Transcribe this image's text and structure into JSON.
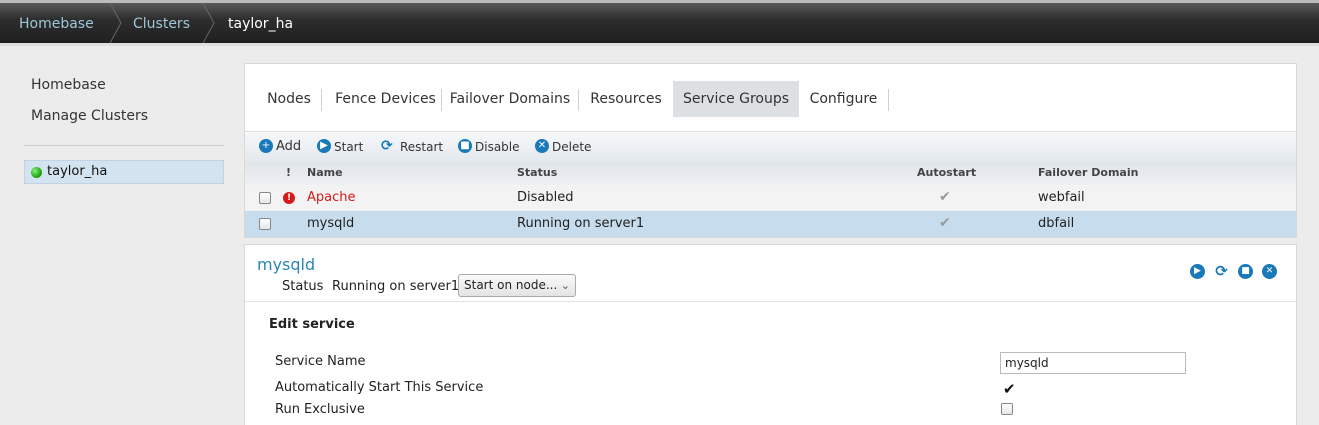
{
  "breadcrumb": {
    "items": [
      "Homebase",
      "Clusters"
    ],
    "current": "taylor_ha"
  },
  "sidebar": {
    "links": [
      "Homebase",
      "Manage Clusters"
    ],
    "cluster": {
      "name": "taylor_ha",
      "status_color": "#22a812"
    }
  },
  "tabs": [
    "Nodes",
    "Fence Devices",
    "Failover Domains",
    "Resources",
    "Service Groups",
    "Configure"
  ],
  "active_tab": "Service Groups",
  "toolbar": {
    "add": "Add",
    "start": "Start",
    "restart": "Restart",
    "disable": "Disable",
    "delete": "Delete"
  },
  "table": {
    "headers": {
      "flag": "!",
      "name": "Name",
      "status": "Status",
      "autostart": "Autostart",
      "failover": "Failover Domain"
    },
    "rows": [
      {
        "name": "Apache",
        "status": "Disabled",
        "autostart": true,
        "failover": "webfail",
        "error": true,
        "selected": false
      },
      {
        "name": "mysqld",
        "status": "Running on server1",
        "autostart": true,
        "failover": "dbfail",
        "error": false,
        "selected": true
      }
    ]
  },
  "detail": {
    "title": "mysqld",
    "status_label": "Status",
    "status_value": "Running on server1",
    "start_select": "Start on node...",
    "edit_heading": "Edit service",
    "fields": {
      "service_name_label": "Service Name",
      "service_name_value": "mysqld",
      "autostart_label": "Automatically Start This Service",
      "autostart_checked": true,
      "exclusive_label": "Run Exclusive",
      "exclusive_checked": false
    }
  },
  "colors": {
    "accent": "#1a79b8",
    "error": "#d61a1a",
    "selected_row": "#c7dcec",
    "link_title": "#2a86b6"
  }
}
